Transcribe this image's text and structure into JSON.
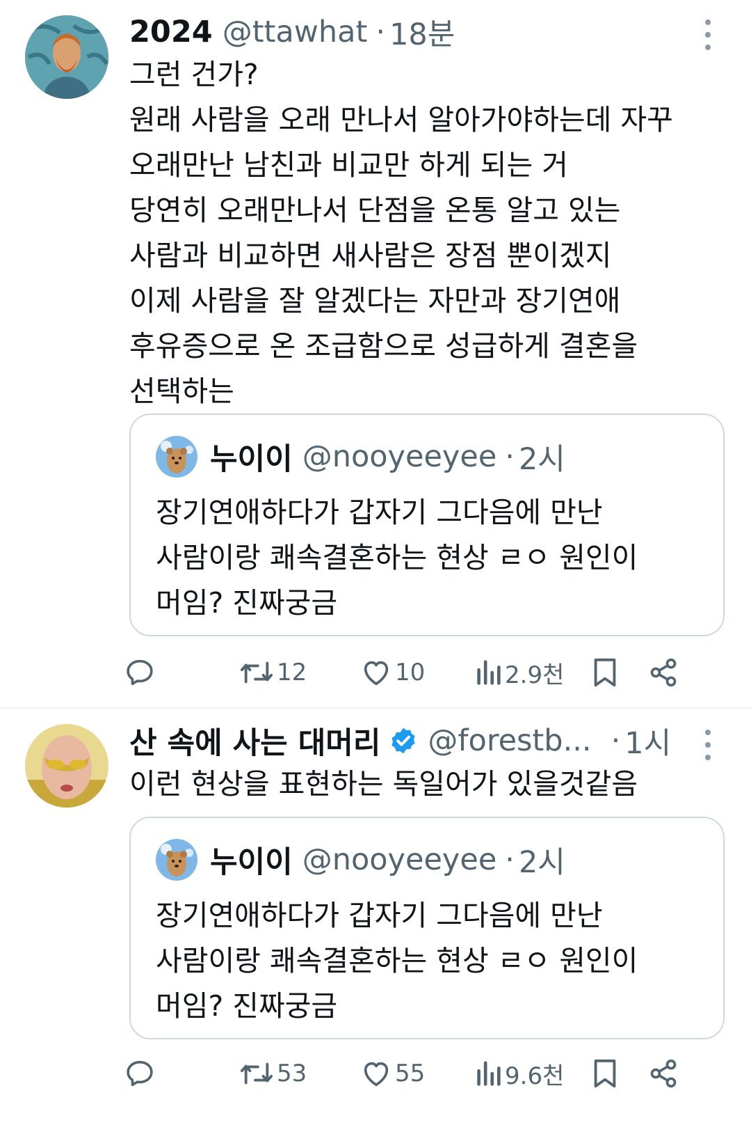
{
  "tweets": [
    {
      "display_name": "2024",
      "handle": "@ttawhat",
      "dot": "·",
      "time": "18분",
      "verified": false,
      "text": "그런 건가?\n원래 사람을 오래 만나서 알아가야하는데 자꾸\n오래만난 남친과 비교만 하게 되는 거\n당연히 오래만나서 단점을 온통 알고 있는\n사람과 비교하면 새사람은 장점 뿐이겠지\n이제 사람을 잘 알겠다는 자만과 장기연애\n후유증으로 온 조급함으로 성급하게 결혼을\n선택하는",
      "quote": {
        "display_name": "누이이",
        "handle": "@nooyeeyee",
        "dot": "·",
        "time": "2시",
        "text": "장기연애하다가 갑자기 그다음에 만난\n사람이랑 쾌속결혼하는 현상 ㄹㅇ 원인이\n머임? 진짜궁금"
      },
      "actions": {
        "reply": "",
        "retweets": "12",
        "likes": "10",
        "views": "2.9천"
      }
    },
    {
      "display_name": "산 속에 사는 대머리",
      "handle": "@forestb...",
      "dot": "·",
      "time": "1시",
      "verified": true,
      "text": "이런 현상을 표현하는 독일어가 있을것같음",
      "quote": {
        "display_name": "누이이",
        "handle": "@nooyeeyee",
        "dot": "·",
        "time": "2시",
        "text": "장기연애하다가 갑자기 그다음에 만난\n사람이랑 쾌속결혼하는 현상 ㄹㅇ 원인이\n머임? 진짜궁금"
      },
      "actions": {
        "reply": "",
        "retweets": "53",
        "likes": "55",
        "views": "9.6천"
      }
    }
  ],
  "colors": {
    "text": "#0f1419",
    "secondary": "#536471",
    "border": "#cfd9de",
    "verified": "#1d9bf0"
  },
  "icons": [
    "reply-icon",
    "retweet-icon",
    "like-icon",
    "views-icon",
    "bookmark-icon",
    "share-icon",
    "more-icon",
    "verified-badge-icon"
  ]
}
